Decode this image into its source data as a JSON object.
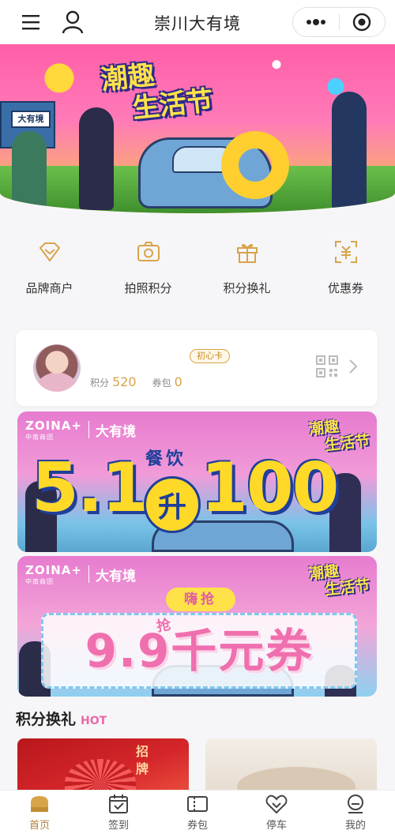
{
  "header": {
    "title": "崇川大有境",
    "menu_icon": "hamburger-menu-icon",
    "profile_icon": "user-icon",
    "more_icon": "more-dots-icon",
    "close_icon": "miniprogram-close-icon"
  },
  "hero": {
    "festival_line1": "潮趣",
    "festival_line2": "生活节",
    "store_sign": "大有境"
  },
  "quick_entries": [
    {
      "label": "品牌商户",
      "icon": "diamond-icon"
    },
    {
      "label": "拍照积分",
      "icon": "camera-icon"
    },
    {
      "label": "积分换礼",
      "icon": "gift-icon"
    },
    {
      "label": "优惠券",
      "icon": "coupon-scan-icon"
    }
  ],
  "member": {
    "tier": "初心卡",
    "points_label": "积分",
    "points_value": "520",
    "coupons_label": "券包",
    "coupons_value": "0"
  },
  "promo1": {
    "brand": "ZOINA",
    "brand_plus": "+",
    "brand_sub": "中南商团",
    "mall": "大有境",
    "festival_line1": "潮趣",
    "festival_line2": "生活节",
    "big_left": "5.1",
    "mid_top": "餐饮",
    "mid": "升",
    "big_right": "100"
  },
  "promo2": {
    "brand": "ZOINA",
    "brand_plus": "+",
    "brand_sub": "中南商团",
    "mall": "大有境",
    "festival_line1": "潮趣",
    "festival_line2": "生活节",
    "hai": "嗨抢",
    "qiang": "抢",
    "main": "9.9千元券"
  },
  "section": {
    "title": "积分换礼",
    "badge": "HOT"
  },
  "goods": [
    {
      "stamp_line1": "招",
      "stamp_line2": "牌"
    }
  ],
  "tabbar": [
    {
      "label": "首页",
      "icon": "home-icon",
      "active": true
    },
    {
      "label": "签到",
      "icon": "checkin-calendar-icon",
      "active": false
    },
    {
      "label": "券包",
      "icon": "ticket-icon",
      "active": false
    },
    {
      "label": "停车",
      "icon": "parking-heart-icon",
      "active": false
    },
    {
      "label": "我的",
      "icon": "profile-icon",
      "active": false
    }
  ],
  "colors": {
    "accent_gold": "#d8a44a",
    "tab_active": "#b07f3a",
    "hot_pink": "#e96aa9"
  }
}
